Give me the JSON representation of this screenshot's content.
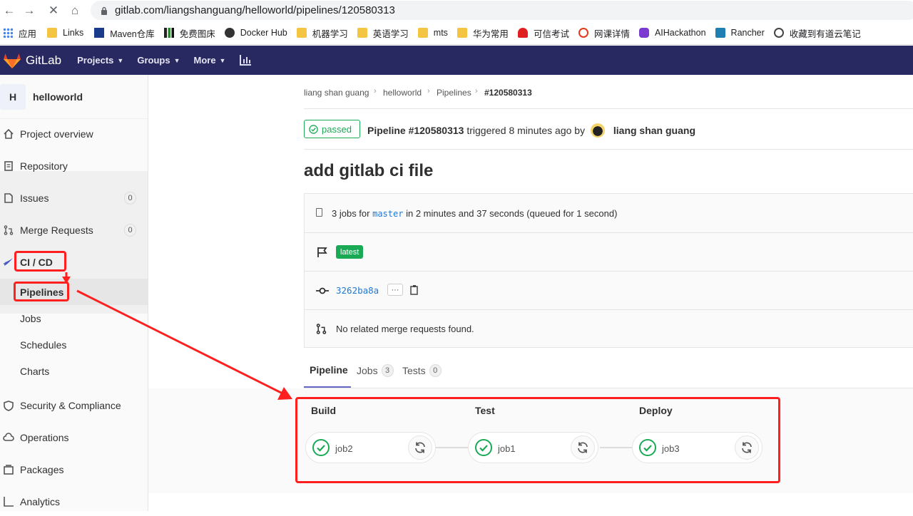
{
  "browser": {
    "url": "gitlab.com/liangshanguang/helloworld/pipelines/120580313",
    "bookmarks": [
      "应用",
      "Links",
      "Maven仓库",
      "免费图床",
      "Docker Hub",
      "机器学习",
      "英语学习",
      "mts",
      "华为常用",
      "可信考试",
      "网课详情",
      "AIHackathon",
      "Rancher",
      "收藏到有道云笔记"
    ]
  },
  "header": {
    "brand": "GitLab",
    "nav": [
      "Projects",
      "Groups",
      "More"
    ]
  },
  "sidebar": {
    "project_initial": "H",
    "project_name": "helloworld",
    "items": [
      {
        "label": "Project overview"
      },
      {
        "label": "Repository"
      },
      {
        "label": "Issues",
        "count": "0"
      },
      {
        "label": "Merge Requests",
        "count": "0"
      },
      {
        "label": "CI / CD"
      },
      {
        "label": "Security & Compliance"
      },
      {
        "label": "Operations"
      },
      {
        "label": "Packages"
      },
      {
        "label": "Analytics"
      }
    ],
    "cicd_sub": [
      "Pipelines",
      "Jobs",
      "Schedules",
      "Charts"
    ]
  },
  "breadcrumb": [
    "liang shan guang",
    "helloworld",
    "Pipelines",
    "#120580313"
  ],
  "pipeline": {
    "status": "passed",
    "id_label": "Pipeline #120580313",
    "triggered_text": "triggered 8 minutes ago by",
    "author": "liang shan guang",
    "title": "add gitlab ci file",
    "jobs_prefix": "3 jobs for",
    "branch": "master",
    "jobs_suffix": "in 2 minutes and 37 seconds (queued for 1 second)",
    "tag": "latest",
    "commit_sha": "3262ba8a",
    "ellipsis": "···",
    "no_mr_text": "No related merge requests found."
  },
  "tabs": [
    {
      "label": "Pipeline"
    },
    {
      "label": "Jobs",
      "count": "3"
    },
    {
      "label": "Tests",
      "count": "0"
    }
  ],
  "stages": [
    {
      "name": "Build",
      "job": "job2"
    },
    {
      "name": "Test",
      "job": "job1"
    },
    {
      "name": "Deploy",
      "job": "job3"
    }
  ],
  "colors": {
    "header_bg": "#292961",
    "success": "#1aaa55",
    "annotation_red": "#ff1f1f"
  }
}
